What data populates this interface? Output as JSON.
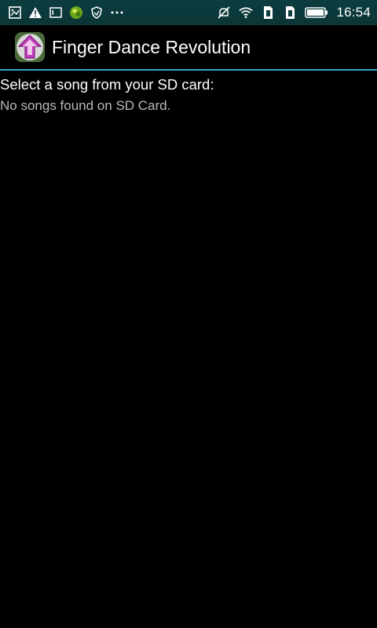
{
  "status_bar": {
    "left_icons": [
      "gallery-icon",
      "warning-icon",
      "notes-icon",
      "app-notification-icon",
      "shield-icon",
      "more-dots-icon"
    ],
    "right_icons": [
      "mute-icon",
      "wifi-icon",
      "sim1-icon",
      "sim2-icon",
      "battery-icon"
    ],
    "time": "16:54"
  },
  "app_bar": {
    "title": "Finger Dance Revolution",
    "icon": "arrow-up-app-icon"
  },
  "content": {
    "prompt": "Select a song from your SD card:",
    "empty_message": "No songs found on SD Card."
  },
  "colors": {
    "status_bar_bg": "#0d3d3f",
    "divider": "#33a2c4",
    "background": "#000000",
    "primary_text": "#ffffff",
    "secondary_text": "#b8b8b8"
  }
}
